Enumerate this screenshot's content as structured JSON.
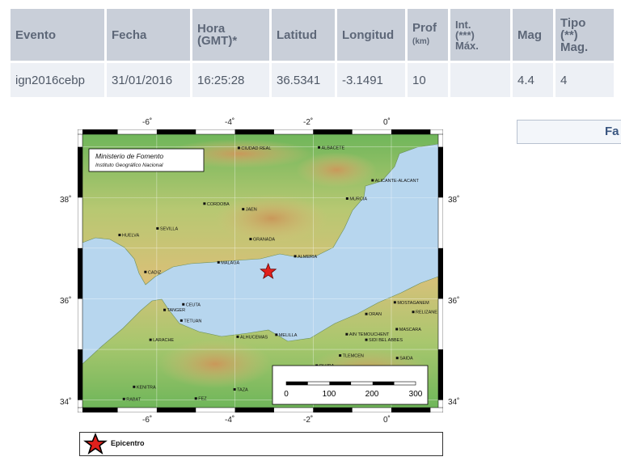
{
  "table": {
    "headers": [
      {
        "main": "Evento",
        "sub": ""
      },
      {
        "main": "Fecha",
        "sub": ""
      },
      {
        "main": "Hora",
        "sub": "(GMT)*"
      },
      {
        "main": "Latitud",
        "sub": ""
      },
      {
        "main": "Longitud",
        "sub": ""
      },
      {
        "main": "Prof",
        "sub": "(km)"
      },
      {
        "main": "Int.",
        "sub": "(***)",
        "sub2": "Máx."
      },
      {
        "main": "Mag",
        "sub": ""
      },
      {
        "main": "Tipo",
        "sub": "(**)",
        "sub2": "Mag."
      }
    ],
    "row": {
      "evento": "ign2016cebp",
      "fecha": "31/01/2016",
      "hora": "16:25:28",
      "latitud": "36.5341",
      "longitud": "-3.1491",
      "prof": "10",
      "int_max": "",
      "mag": "4.4",
      "tipo_mag": "4"
    }
  },
  "side_button": {
    "label": "Fa"
  },
  "map": {
    "credit_line1": "Ministerio de Fomento",
    "credit_line2": "Instituto Geográfico Nacional",
    "top_ticks": [
      "-6˚",
      "-4˚",
      "-2˚",
      "0˚"
    ],
    "bottom_ticks": [
      "-6˚",
      "-4˚",
      "-2˚",
      "0˚"
    ],
    "left_ticks": [
      "38˚",
      "36˚",
      "34˚"
    ],
    "right_ticks": [
      "38˚",
      "36˚",
      "34˚"
    ],
    "scale_labels": [
      "0",
      "100",
      "200",
      "300"
    ],
    "cities": [
      {
        "name": "CIUDAD REAL",
        "lon": -3.9,
        "lat": 38.98
      },
      {
        "name": "ALBACETE",
        "lon": -1.85,
        "lat": 38.99
      },
      {
        "name": "ALICANTE-ALACANT",
        "lon": -0.48,
        "lat": 38.34
      },
      {
        "name": "MURCIA",
        "lon": -1.13,
        "lat": 37.98
      },
      {
        "name": "CORDOBA",
        "lon": -4.78,
        "lat": 37.88
      },
      {
        "name": "JAEN",
        "lon": -3.79,
        "lat": 37.77
      },
      {
        "name": "SEVILLA",
        "lon": -5.98,
        "lat": 37.39
      },
      {
        "name": "HUELVA",
        "lon": -6.95,
        "lat": 37.26
      },
      {
        "name": "GRANADA",
        "lon": -3.6,
        "lat": 37.18
      },
      {
        "name": "ALMERIA",
        "lon": -2.46,
        "lat": 36.84
      },
      {
        "name": "MALAGA",
        "lon": -4.42,
        "lat": 36.72
      },
      {
        "name": "CADIZ",
        "lon": -6.29,
        "lat": 36.53
      },
      {
        "name": "CEUTA",
        "lon": -5.32,
        "lat": 35.89
      },
      {
        "name": "TANGER",
        "lon": -5.8,
        "lat": 35.78
      },
      {
        "name": "TETUAN",
        "lon": -5.37,
        "lat": 35.57
      },
      {
        "name": "LARACHE",
        "lon": -6.16,
        "lat": 35.19
      },
      {
        "name": "ALHUCEMAS",
        "lon": -3.93,
        "lat": 35.25
      },
      {
        "name": "MELILLA",
        "lon": -2.94,
        "lat": 35.29
      },
      {
        "name": "ORAN",
        "lon": -0.64,
        "lat": 35.7
      },
      {
        "name": "MOSTAGANEM",
        "lon": 0.09,
        "lat": 35.93
      },
      {
        "name": "RELIZANE",
        "lon": 0.56,
        "lat": 35.74
      },
      {
        "name": "AIN TEMOUCHENT",
        "lon": -1.14,
        "lat": 35.3
      },
      {
        "name": "SIDI BEL ABBES",
        "lon": -0.64,
        "lat": 35.19
      },
      {
        "name": "MASCARA",
        "lon": 0.14,
        "lat": 35.4
      },
      {
        "name": "TLEMCEN",
        "lon": -1.31,
        "lat": 34.88
      },
      {
        "name": "SAIDA",
        "lon": 0.15,
        "lat": 34.83
      },
      {
        "name": "OUJDA",
        "lon": -1.91,
        "lat": 34.68
      },
      {
        "name": "KENITRA",
        "lon": -6.58,
        "lat": 34.26
      },
      {
        "name": "RABAT",
        "lon": -6.84,
        "lat": 34.02
      },
      {
        "name": "FEZ",
        "lon": -5.0,
        "lat": 34.03
      },
      {
        "name": "TAZA",
        "lon": -4.01,
        "lat": 34.21
      }
    ],
    "epicenter": {
      "lon": -3.1491,
      "lat": 36.5341
    }
  },
  "legend": {
    "label": "Epicentro"
  },
  "colors": {
    "header_bg": "#c9cfd9",
    "cell_bg": "#edf0f5",
    "sea": "#b8d8ef",
    "land_low": "#7dbf63",
    "land_high": "#dcc27a",
    "epicenter": "#e0201c"
  }
}
